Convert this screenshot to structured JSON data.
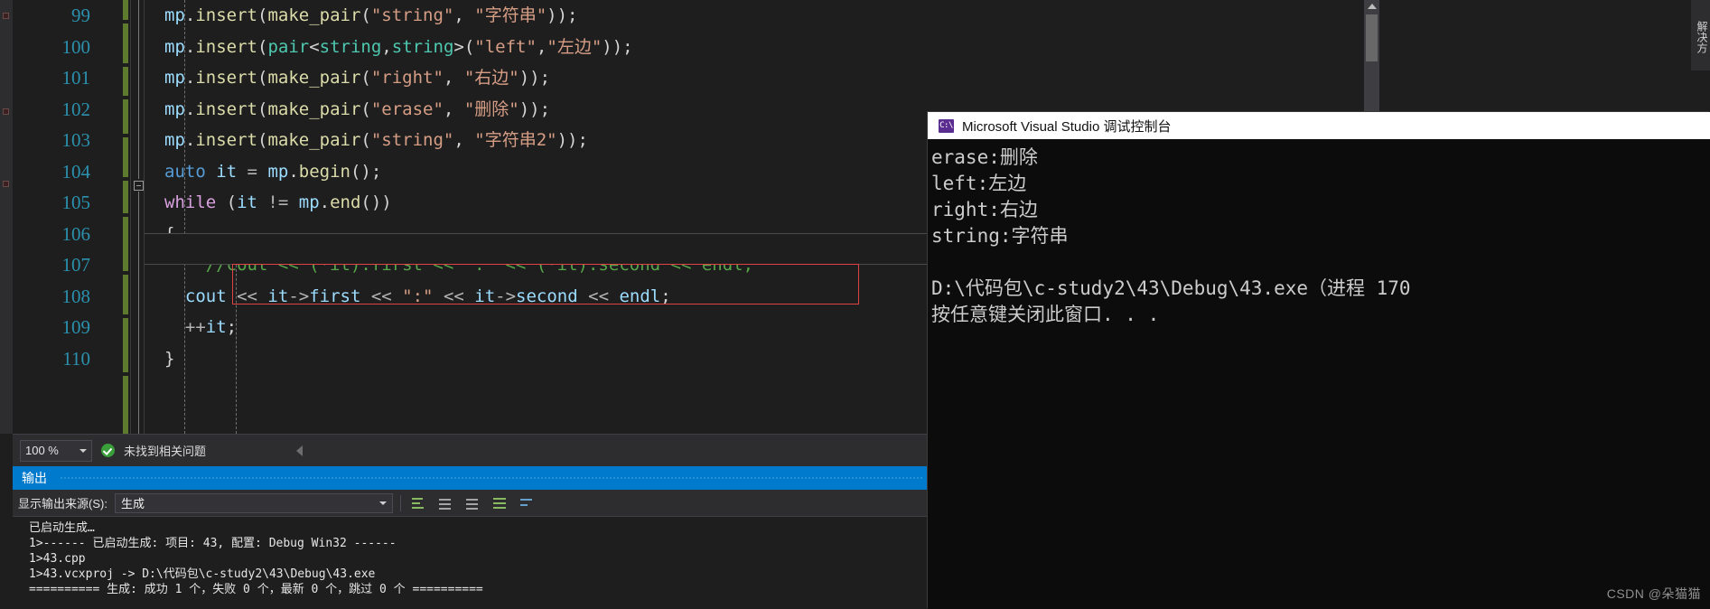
{
  "editor": {
    "gutter_lines": [
      "99",
      "100",
      "101",
      "102",
      "103",
      "104",
      "105",
      "106",
      "107",
      "108",
      "109",
      "110"
    ],
    "lines": [
      {
        "n": "99",
        "segments": [
          {
            "t": "var",
            "s": "mp"
          },
          {
            "t": "punc",
            "s": "."
          },
          {
            "t": "fn",
            "s": "insert"
          },
          {
            "t": "punc",
            "s": "("
          },
          {
            "t": "fn",
            "s": "make_pair"
          },
          {
            "t": "punc",
            "s": "("
          },
          {
            "t": "str",
            "s": "\"string\""
          },
          {
            "t": "punc",
            "s": ", "
          },
          {
            "t": "str",
            "s": "\"字符串\""
          },
          {
            "t": "punc",
            "s": "));"
          }
        ]
      },
      {
        "n": "100",
        "segments": [
          {
            "t": "var",
            "s": "mp"
          },
          {
            "t": "punc",
            "s": "."
          },
          {
            "t": "fn",
            "s": "insert"
          },
          {
            "t": "punc",
            "s": "("
          },
          {
            "t": "type",
            "s": "pair"
          },
          {
            "t": "punc",
            "s": "<"
          },
          {
            "t": "type",
            "s": "string"
          },
          {
            "t": "punc",
            "s": ","
          },
          {
            "t": "type",
            "s": "string"
          },
          {
            "t": "punc",
            "s": ">("
          },
          {
            "t": "str",
            "s": "\"left\""
          },
          {
            "t": "punc",
            "s": ","
          },
          {
            "t": "str",
            "s": "\"左边\""
          },
          {
            "t": "punc",
            "s": "));"
          }
        ]
      },
      {
        "n": "101",
        "segments": [
          {
            "t": "var",
            "s": "mp"
          },
          {
            "t": "punc",
            "s": "."
          },
          {
            "t": "fn",
            "s": "insert"
          },
          {
            "t": "punc",
            "s": "("
          },
          {
            "t": "fn",
            "s": "make_pair"
          },
          {
            "t": "punc",
            "s": "("
          },
          {
            "t": "str",
            "s": "\"right\""
          },
          {
            "t": "punc",
            "s": ", "
          },
          {
            "t": "str",
            "s": "\"右边\""
          },
          {
            "t": "punc",
            "s": "));"
          }
        ]
      },
      {
        "n": "102",
        "segments": [
          {
            "t": "var",
            "s": "mp"
          },
          {
            "t": "punc",
            "s": "."
          },
          {
            "t": "fn",
            "s": "insert"
          },
          {
            "t": "punc",
            "s": "("
          },
          {
            "t": "fn",
            "s": "make_pair"
          },
          {
            "t": "punc",
            "s": "("
          },
          {
            "t": "str",
            "s": "\"erase\""
          },
          {
            "t": "punc",
            "s": ", "
          },
          {
            "t": "str",
            "s": "\"删除\""
          },
          {
            "t": "punc",
            "s": "));"
          }
        ]
      },
      {
        "n": "103",
        "segments": [
          {
            "t": "var",
            "s": "mp"
          },
          {
            "t": "punc",
            "s": "."
          },
          {
            "t": "fn",
            "s": "insert"
          },
          {
            "t": "punc",
            "s": "("
          },
          {
            "t": "fn",
            "s": "make_pair"
          },
          {
            "t": "punc",
            "s": "("
          },
          {
            "t": "str",
            "s": "\"string\""
          },
          {
            "t": "punc",
            "s": ", "
          },
          {
            "t": "str",
            "s": "\"字符串2\""
          },
          {
            "t": "punc",
            "s": "));"
          }
        ]
      },
      {
        "n": "104",
        "segments": [
          {
            "t": "kw",
            "s": "auto"
          },
          {
            "t": "punc",
            "s": " "
          },
          {
            "t": "var",
            "s": "it"
          },
          {
            "t": "op",
            "s": " = "
          },
          {
            "t": "var",
            "s": "mp"
          },
          {
            "t": "punc",
            "s": "."
          },
          {
            "t": "fn",
            "s": "begin"
          },
          {
            "t": "punc",
            "s": "();"
          }
        ]
      },
      {
        "n": "105",
        "segments": [
          {
            "t": "kw2",
            "s": "while"
          },
          {
            "t": "punc",
            "s": " ("
          },
          {
            "t": "var",
            "s": "it"
          },
          {
            "t": "op",
            "s": " != "
          },
          {
            "t": "var",
            "s": "mp"
          },
          {
            "t": "punc",
            "s": "."
          },
          {
            "t": "fn",
            "s": "end"
          },
          {
            "t": "punc",
            "s": "())"
          }
        ]
      },
      {
        "n": "106",
        "segments": [
          {
            "t": "punc",
            "s": "{"
          }
        ]
      },
      {
        "n": "107",
        "segments": [
          {
            "t": "cmt",
            "s": "    //cout << (*it).first << \":\" << (*it).second << endl;"
          }
        ]
      },
      {
        "n": "108",
        "segments": [
          {
            "t": "punc",
            "s": "  "
          },
          {
            "t": "var",
            "s": "cout"
          },
          {
            "t": "op",
            "s": " << "
          },
          {
            "t": "var",
            "s": "it"
          },
          {
            "t": "op",
            "s": "->"
          },
          {
            "t": "var",
            "s": "first"
          },
          {
            "t": "op",
            "s": " << "
          },
          {
            "t": "str",
            "s": "\":\""
          },
          {
            "t": "op",
            "s": " << "
          },
          {
            "t": "var",
            "s": "it"
          },
          {
            "t": "op",
            "s": "->"
          },
          {
            "t": "var",
            "s": "second"
          },
          {
            "t": "op",
            "s": " << "
          },
          {
            "t": "var",
            "s": "endl"
          },
          {
            "t": "punc",
            "s": ";"
          }
        ]
      },
      {
        "n": "109",
        "segments": [
          {
            "t": "punc",
            "s": "  "
          },
          {
            "t": "op",
            "s": "++"
          },
          {
            "t": "var",
            "s": "it"
          },
          {
            "t": "punc",
            "s": ";"
          }
        ]
      },
      {
        "n": "110",
        "segments": [
          {
            "t": "punc",
            "s": "}"
          }
        ]
      }
    ]
  },
  "editor_status": {
    "zoom_level": "100 %",
    "issues_text": "未找到相关问题"
  },
  "output_pane": {
    "title": "输出",
    "source_label": "显示输出来源(S):",
    "source_value": "生成",
    "lines": [
      "已启动生成…",
      "1>------ 已启动生成: 项目: 43, 配置: Debug Win32 ------",
      "1>43.cpp",
      "1>43.vcxproj -> D:\\代码包\\c-study2\\43\\Debug\\43.exe",
      "========== 生成: 成功 1 个，失败 0 个，最新 0 个，跳过 0 个 =========="
    ]
  },
  "console_window": {
    "icon_label": "C:\\",
    "title": "Microsoft Visual Studio 调试控制台",
    "lines": [
      "erase:删除",
      "left:左边",
      "right:右边",
      "string:字符串",
      "",
      "D:\\代码包\\c-study2\\43\\Debug\\43.exe（进程 170",
      "按任意键关闭此窗口. . ."
    ]
  },
  "right_panel": {
    "vertical_tab_label": "解决方"
  },
  "watermark": {
    "text": "CSDN @朵猫猫"
  },
  "colors": {
    "accent": "#007acc",
    "editor_bg": "#1e1e1e",
    "console_bg": "#0c0c0c",
    "error_box": "#e04343",
    "change_bar": "#5d7a2f"
  }
}
